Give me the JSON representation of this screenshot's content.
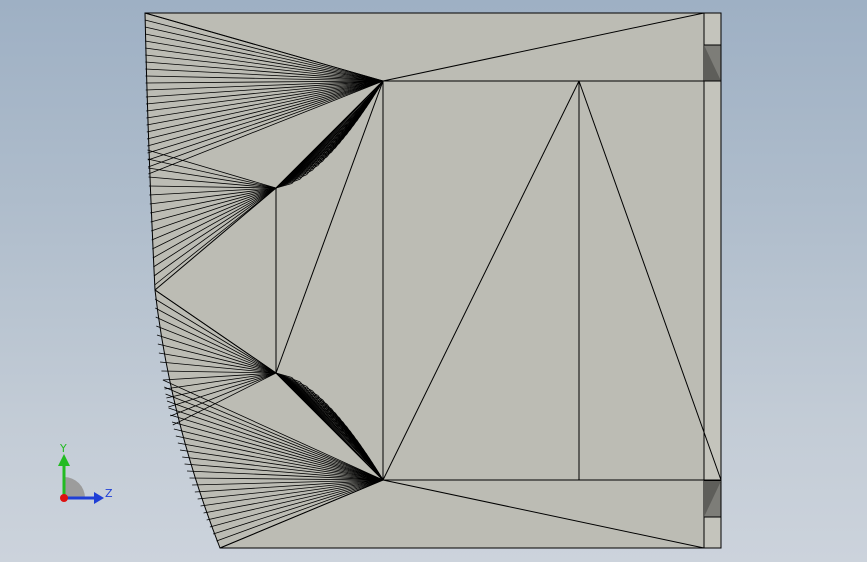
{
  "viewport": {
    "background_top": "#9eb0c4",
    "background_bottom": "#ccd3dc",
    "face_color": "#bcbcb4",
    "edge_color": "#000000",
    "dark_face_color": "#7d7d78"
  },
  "triad": {
    "y_label": "Y",
    "z_label": "Z",
    "y_color": "#22bb22",
    "z_color": "#1f3fd6",
    "x_color": "#dd1111"
  }
}
